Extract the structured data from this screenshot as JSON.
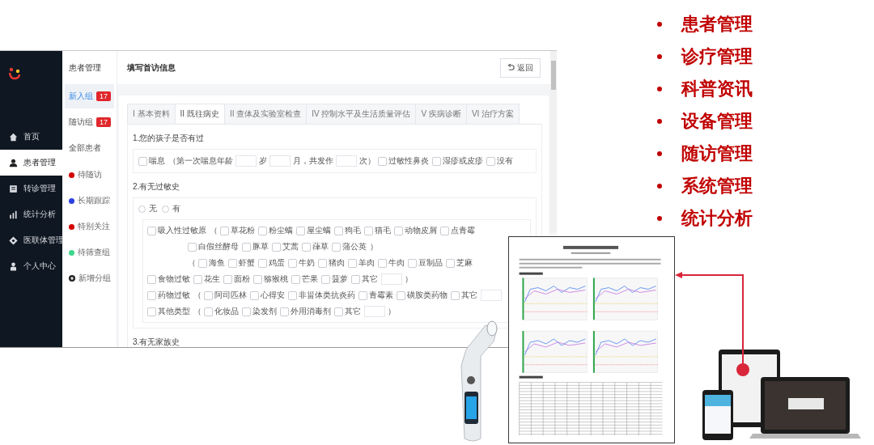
{
  "slide_features": [
    "患者管理",
    "诊疗管理",
    "科普资讯",
    "设备管理",
    "随访管理",
    "系统管理",
    "统计分析"
  ],
  "sidebar": {
    "items": [
      {
        "label": "首页",
        "selected": false
      },
      {
        "label": "患者管理",
        "selected": true
      },
      {
        "label": "转诊管理",
        "selected": false
      },
      {
        "label": "统计分析",
        "selected": false
      },
      {
        "label": "医联体管理",
        "selected": false
      },
      {
        "label": "个人中心",
        "selected": false
      }
    ]
  },
  "subnav": {
    "title": "患者管理",
    "items": [
      {
        "label": "新入组",
        "badge": "17",
        "selected": true
      },
      {
        "label": "随访组",
        "badge": "17",
        "selected": false
      },
      {
        "label": "全部患者",
        "selected": false
      }
    ],
    "groups": [
      {
        "label": "待随访",
        "color": "#d40000"
      },
      {
        "label": "长期跟踪",
        "color": "#2a3fe0"
      },
      {
        "label": "特别关注",
        "color": "#d40000"
      },
      {
        "label": "待筛查组",
        "color": "#3fd68c"
      }
    ],
    "add_group": "新增分组"
  },
  "page": {
    "title": "填写首访信息",
    "back_button": "返回",
    "tabs": [
      {
        "label": "I 基本资料",
        "selected": false
      },
      {
        "label": "II 既往病史",
        "selected": true
      },
      {
        "label": "II 查体及实验室检查",
        "selected": false
      },
      {
        "label": "IV 控制水平及生活质量评估",
        "selected": false
      },
      {
        "label": "V 疾病诊断",
        "selected": false
      },
      {
        "label": "VI 治疗方案",
        "selected": false
      }
    ],
    "sections": [
      {
        "title": "1.您的孩子是否有过",
        "rows": [
          {
            "kind": "main",
            "items": [
              {
                "kind": "check",
                "label": "喘息",
                "checked": false
              },
              {
                "kind": "text",
                "text": "（第一次喘息年龄"
              },
              {
                "kind": "input"
              },
              {
                "kind": "text",
                "text": "岁"
              },
              {
                "kind": "input"
              },
              {
                "kind": "text",
                "text": "月，共发作"
              },
              {
                "kind": "input"
              },
              {
                "kind": "text",
                "text": "次）"
              },
              {
                "kind": "check",
                "label": "过敏性鼻炎",
                "checked": false
              },
              {
                "kind": "check",
                "label": "湿疹或皮疹",
                "checked": false
              },
              {
                "kind": "check",
                "label": "没有",
                "checked": false
              }
            ]
          }
        ]
      },
      {
        "title": "2.有无过敏史",
        "radios": [
          {
            "label": "无",
            "selected": false
          },
          {
            "label": "有",
            "selected": false
          }
        ],
        "rows": [
          {
            "kind": "main",
            "items": [
              {
                "kind": "check",
                "label": "吸入性过敏原",
                "checked": false
              },
              {
                "kind": "text",
                "text": "（"
              },
              {
                "kind": "check",
                "label": "草花粉",
                "checked": false
              },
              {
                "kind": "check",
                "label": "粉尘螨",
                "checked": false
              },
              {
                "kind": "check",
                "label": "屋尘螨",
                "checked": false
              },
              {
                "kind": "check",
                "label": "狗毛",
                "checked": false
              },
              {
                "kind": "check",
                "label": "猫毛",
                "checked": false
              },
              {
                "kind": "check",
                "label": "动物皮屑",
                "checked": false
              },
              {
                "kind": "check",
                "label": "点青霉",
                "checked": false
              }
            ]
          },
          {
            "kind": "continuation",
            "items": [
              {
                "kind": "check",
                "label": "白假丝酵母",
                "checked": false
              },
              {
                "kind": "check",
                "label": "豚草",
                "checked": false
              },
              {
                "kind": "check",
                "label": "艾蒿",
                "checked": false
              },
              {
                "kind": "check",
                "label": "葎草",
                "checked": false
              },
              {
                "kind": "check",
                "label": "蒲公英",
                "checked": false
              },
              {
                "kind": "text",
                "text": "）"
              }
            ]
          },
          {
            "kind": "continuation",
            "items": [
              {
                "kind": "text",
                "text": "（"
              },
              {
                "kind": "check",
                "label": "海鱼",
                "checked": false
              },
              {
                "kind": "check",
                "label": "虾蟹",
                "checked": false
              },
              {
                "kind": "check",
                "label": "鸡蛋",
                "checked": false
              },
              {
                "kind": "check",
                "label": "牛奶",
                "checked": false
              },
              {
                "kind": "check",
                "label": "猪肉",
                "checked": false
              },
              {
                "kind": "check",
                "label": "羊肉",
                "checked": false
              },
              {
                "kind": "check",
                "label": "牛肉",
                "checked": false
              },
              {
                "kind": "check",
                "label": "豆制品",
                "checked": false
              },
              {
                "kind": "check",
                "label": "芝麻",
                "checked": false
              }
            ]
          },
          {
            "kind": "main",
            "items": [
              {
                "kind": "check",
                "label": "食物过敏",
                "checked": false
              },
              {
                "kind": "check",
                "label": "花生",
                "checked": false
              },
              {
                "kind": "check",
                "label": "面粉",
                "checked": false
              },
              {
                "kind": "check",
                "label": "猕猴桃",
                "checked": false
              },
              {
                "kind": "check",
                "label": "芒果",
                "checked": false
              },
              {
                "kind": "check",
                "label": "菠萝",
                "checked": false
              },
              {
                "kind": "check",
                "label": "其它",
                "checked": false
              },
              {
                "kind": "input"
              },
              {
                "kind": "text",
                "text": "）"
              }
            ]
          },
          {
            "kind": "main",
            "items": [
              {
                "kind": "check",
                "label": "药物过敏",
                "checked": false
              },
              {
                "kind": "text",
                "text": "（"
              },
              {
                "kind": "check",
                "label": "阿司匹林",
                "checked": false
              },
              {
                "kind": "check",
                "label": "心得安",
                "checked": false
              },
              {
                "kind": "check",
                "label": "非甾体类抗炎药",
                "checked": false
              },
              {
                "kind": "check",
                "label": "青霉素",
                "checked": false
              },
              {
                "kind": "check",
                "label": "磺胺类药物",
                "checked": false
              },
              {
                "kind": "check",
                "label": "其它",
                "checked": false
              },
              {
                "kind": "input"
              }
            ]
          },
          {
            "kind": "main",
            "items": [
              {
                "kind": "check",
                "label": "其他类型",
                "checked": false
              },
              {
                "kind": "text",
                "text": "（"
              },
              {
                "kind": "check",
                "label": "化妆品",
                "checked": false
              },
              {
                "kind": "check",
                "label": "染发剂",
                "checked": false
              },
              {
                "kind": "check",
                "label": "外用消毒剂",
                "checked": false
              },
              {
                "kind": "check",
                "label": "其它",
                "checked": false
              },
              {
                "kind": "input"
              },
              {
                "kind": "text",
                "text": "）"
              }
            ]
          }
        ]
      },
      {
        "title": "3.有无家族史"
      }
    ]
  }
}
